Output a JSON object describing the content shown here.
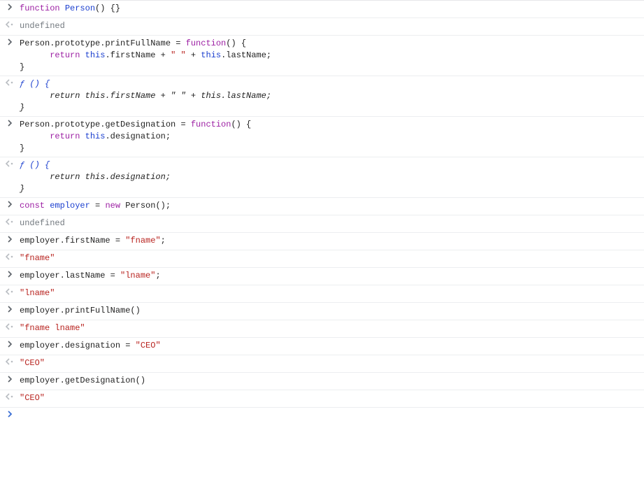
{
  "entries": [
    {
      "kind": "input",
      "tokens": [
        {
          "c": "t-kw",
          "t": "function"
        },
        {
          "c": "",
          "t": " "
        },
        {
          "c": "t-fn",
          "t": "Person"
        },
        {
          "c": "",
          "t": "() {}"
        }
      ]
    },
    {
      "kind": "output",
      "tokens": [
        {
          "c": "t-undef",
          "t": "undefined"
        }
      ]
    },
    {
      "kind": "input",
      "tokens": [
        {
          "c": "",
          "t": "Person.prototype.printFullName = "
        },
        {
          "c": "t-kw",
          "t": "function"
        },
        {
          "c": "",
          "t": "() {\n      "
        },
        {
          "c": "t-kw",
          "t": "return"
        },
        {
          "c": "",
          "t": " "
        },
        {
          "c": "t-this",
          "t": "this"
        },
        {
          "c": "",
          "t": ".firstName + "
        },
        {
          "c": "t-str",
          "t": "\" \""
        },
        {
          "c": "",
          "t": " + "
        },
        {
          "c": "t-this",
          "t": "this"
        },
        {
          "c": "",
          "t": ".lastName;\n}"
        }
      ]
    },
    {
      "kind": "output",
      "italic": true,
      "tokens": [
        {
          "c": "t-fsym",
          "t": "ƒ () {"
        },
        {
          "c": "italic",
          "t": "\n      return this.firstName + \" \" + this.lastName;\n}"
        }
      ]
    },
    {
      "kind": "input",
      "tokens": [
        {
          "c": "",
          "t": "Person.prototype.getDesignation = "
        },
        {
          "c": "t-kw",
          "t": "function"
        },
        {
          "c": "",
          "t": "() {\n      "
        },
        {
          "c": "t-kw",
          "t": "return"
        },
        {
          "c": "",
          "t": " "
        },
        {
          "c": "t-this",
          "t": "this"
        },
        {
          "c": "",
          "t": ".designation;\n}"
        }
      ]
    },
    {
      "kind": "output",
      "italic": true,
      "tokens": [
        {
          "c": "t-fsym",
          "t": "ƒ () {"
        },
        {
          "c": "italic",
          "t": "\n      return this.designation;\n}"
        }
      ]
    },
    {
      "kind": "input",
      "tokens": [
        {
          "c": "t-kw",
          "t": "const"
        },
        {
          "c": "",
          "t": " "
        },
        {
          "c": "t-fn",
          "t": "employer"
        },
        {
          "c": "",
          "t": " = "
        },
        {
          "c": "t-kw",
          "t": "new"
        },
        {
          "c": "",
          "t": " Person();"
        }
      ]
    },
    {
      "kind": "output",
      "tokens": [
        {
          "c": "t-undef",
          "t": "undefined"
        }
      ]
    },
    {
      "kind": "input",
      "tokens": [
        {
          "c": "",
          "t": "employer.firstName = "
        },
        {
          "c": "t-str",
          "t": "\"fname\""
        },
        {
          "c": "",
          "t": ";"
        }
      ]
    },
    {
      "kind": "output",
      "tokens": [
        {
          "c": "t-str",
          "t": "\"fname\""
        }
      ]
    },
    {
      "kind": "input",
      "tokens": [
        {
          "c": "",
          "t": "employer.lastName = "
        },
        {
          "c": "t-str",
          "t": "\"lname\""
        },
        {
          "c": "",
          "t": ";"
        }
      ]
    },
    {
      "kind": "output",
      "tokens": [
        {
          "c": "t-str",
          "t": "\"lname\""
        }
      ]
    },
    {
      "kind": "input",
      "tokens": [
        {
          "c": "",
          "t": "employer.printFullName()"
        }
      ]
    },
    {
      "kind": "output",
      "tokens": [
        {
          "c": "t-str",
          "t": "\"fname lname\""
        }
      ]
    },
    {
      "kind": "input",
      "tokens": [
        {
          "c": "",
          "t": "employer.designation = "
        },
        {
          "c": "t-str",
          "t": "\"CEO\""
        }
      ]
    },
    {
      "kind": "output",
      "tokens": [
        {
          "c": "t-str",
          "t": "\"CEO\""
        }
      ]
    },
    {
      "kind": "input",
      "tokens": [
        {
          "c": "",
          "t": "employer.getDesignation()"
        }
      ]
    },
    {
      "kind": "output",
      "tokens": [
        {
          "c": "t-str",
          "t": "\"CEO\""
        }
      ]
    },
    {
      "kind": "prompt",
      "tokens": []
    }
  ],
  "glyphs": {
    "input": "›",
    "output": "‹·",
    "prompt": "›"
  }
}
